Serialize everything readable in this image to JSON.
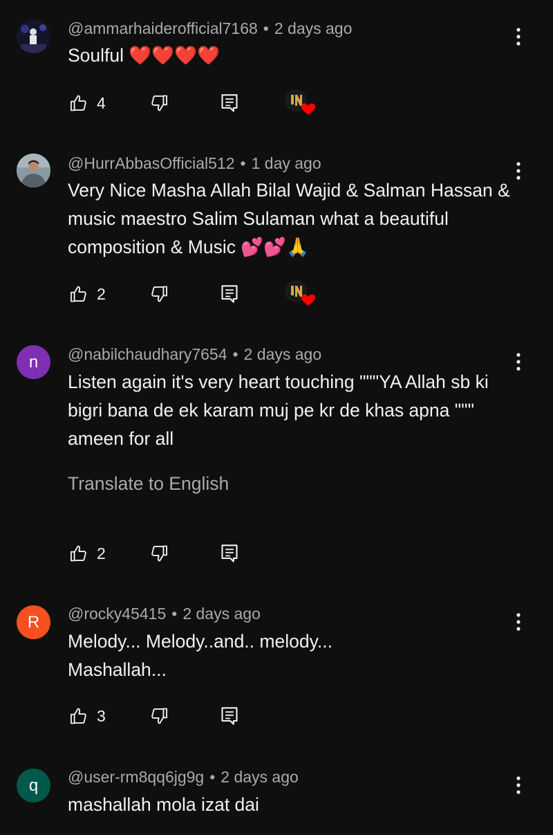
{
  "comments": [
    {
      "author": "@ammarhaiderofficial7168",
      "time": "2 days ago",
      "text": "Soulful ❤️❤️❤️❤️",
      "likes": "4",
      "avatar_letter": "",
      "creator_heart": true
    },
    {
      "author": "@HurrAbbasOfficial512",
      "time": "1 day ago",
      "text": "Very Nice Masha Allah Bilal Wajid & Salman Hassan & music maestro Salim Sulaman what a beautiful composition & Music 💕💕🙏",
      "likes": "2",
      "avatar_letter": "",
      "creator_heart": true
    },
    {
      "author": "@nabilchaudhary7654",
      "time": "2 days ago",
      "text": "Listen again it's very heart touching \"\"\"YA Allah sb ki bigri bana de ek karam muj pe kr de khas apna \"\"\" ameen for all",
      "translate": "Translate to English",
      "likes": "2",
      "avatar_letter": "n",
      "avatar_color": "#7e2fb2",
      "creator_heart": false
    },
    {
      "author": "@rocky45415",
      "time": "2 days ago",
      "text": "Melody... Melody..and.. melody... Mashallah...",
      "likes": "3",
      "avatar_letter": "R",
      "avatar_color": "#f4511e",
      "creator_heart": false
    },
    {
      "author": "@user-rm8qq6jg9g",
      "time": "2 days ago",
      "text": "mashallah mola izat dai",
      "avatar_letter": "q",
      "avatar_color": "#00594a",
      "creator_heart": false
    }
  ],
  "separator": "•",
  "icons": {
    "like": "thumbs-up-icon",
    "dislike": "thumbs-down-icon",
    "reply": "reply-comment-icon",
    "more": "more-vertical-icon",
    "heart": "creator-heart-icon"
  },
  "colors": {
    "background": "#0f0f0f",
    "text": "#f1f1f1",
    "secondary": "#aaaaaa",
    "heart": "#ff0000"
  }
}
